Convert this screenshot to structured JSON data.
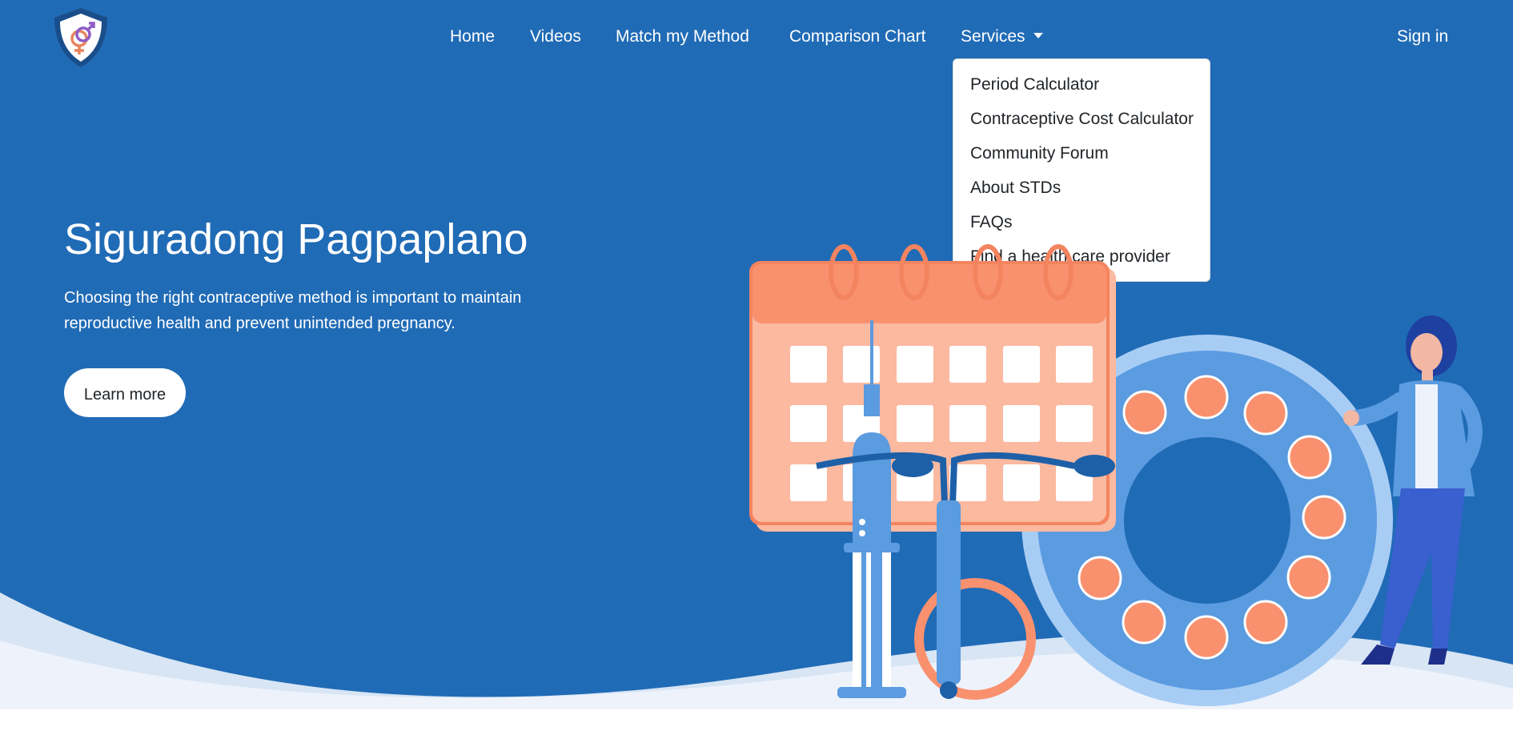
{
  "nav": {
    "logo_icon": "shield-gender-icon",
    "links": [
      "Home",
      "Videos",
      "Match my Method",
      "Comparison Chart"
    ],
    "services_label": "Services",
    "signin_label": "Sign in"
  },
  "dropdown": {
    "items": [
      "Period Calculator",
      "Contraceptive Cost Calculator",
      "Community Forum",
      "About STDs",
      "FAQs",
      "Find a health care provider"
    ]
  },
  "hero": {
    "title": "Siguradong Pagpaplano",
    "description": "Choosing the right contraceptive method is important to maintain reproductive health and prevent unintended pregnancy.",
    "button_label": "Learn more"
  },
  "colors": {
    "hero_bg": "#206bb6",
    "calendar": "#f9916f",
    "pill_ring": "#5b9be0",
    "wave_light": "#d7e5f4"
  }
}
